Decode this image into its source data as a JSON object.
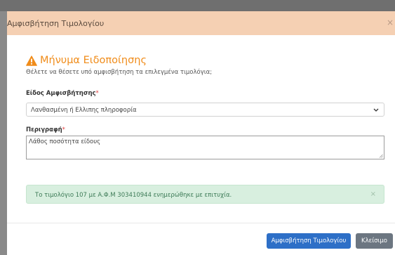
{
  "modal": {
    "title": "Αμφισβήτηση Τιμολογίου",
    "close_symbol": "×"
  },
  "notice": {
    "icon": "warning-triangle-icon",
    "title": "Μήνυμα Ειδοποίησης",
    "subtitle": "Θέλετε να θέσετε υπό αμφισβήτηση τα επιλεγμένα τιμολόγια;"
  },
  "form": {
    "type_label": "Είδος Αμφισβήτησης",
    "required_mark": "*",
    "type_value": "Λανθασμένη ή Ελλιπης πληροφορία",
    "description_label": "Περιγραφή",
    "description_value": "Λάθος ποσότητα είδους"
  },
  "alert": {
    "message": "Το τιμολόγιο 107 με Α.Φ.Μ 303410944 ενημερώθηκε με επιτυχία.",
    "close_symbol": "×"
  },
  "footer": {
    "primary_label": "Αμφισβήτηση Τιμολογίου",
    "secondary_label": "Κλείσιμο"
  },
  "colors": {
    "header_bg": "#f5d0b3",
    "warning": "#f08c1a",
    "alert_bg": "#d8efdf",
    "primary_button": "#2d6fc7",
    "secondary_button": "#6c7681"
  }
}
